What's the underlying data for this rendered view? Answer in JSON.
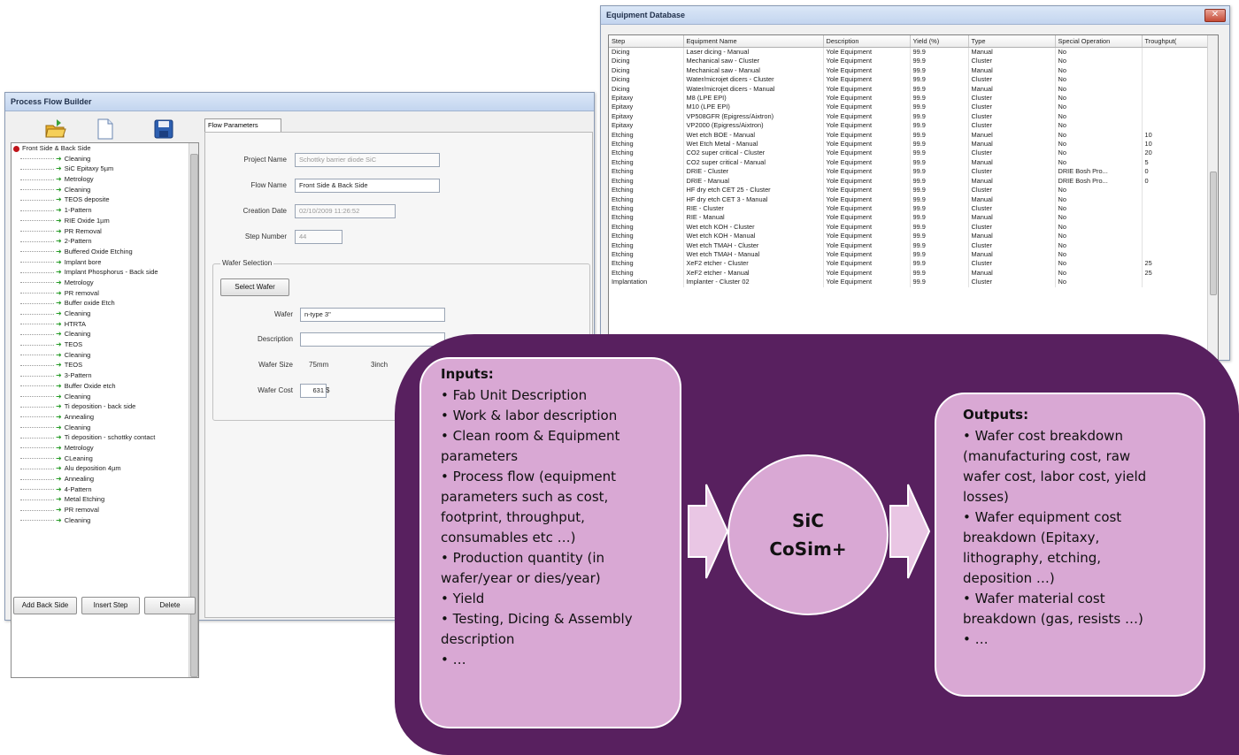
{
  "process_flow_builder": {
    "title": "Process Flow Builder",
    "toolbar_icons": [
      "folder-open-icon",
      "new-document-icon",
      "save-icon"
    ],
    "tree": {
      "root": "Front Side & Back Side",
      "items": [
        "Cleaning",
        "SiC Epitaxy 5µm",
        "Metrology",
        "Cleaning",
        "TEOS deposite",
        "1-Pattern",
        "RIE Oxide 1µm",
        "PR Removal",
        "2-Pattern",
        "Buffered Oxide Etching",
        "Implant bore",
        "Implant Phosphorus - Back side",
        "Metrology",
        "PR removal",
        "Buffer oxide Etch",
        "Cleaning",
        "HTRTA",
        "Cleaning",
        "TEOS",
        "Cleaning",
        "TEOS",
        "3-Pattern",
        "Buffer Oxide etch",
        "Cleaning",
        "Ti deposition - back side",
        "Annealing",
        "Cleaning",
        "Ti deposition - schottky contact",
        "Metrology",
        "CLeaning",
        "Alu deposition 4µm",
        "Annealing",
        "4-Pattern",
        "Metal Etching",
        "PR removal",
        "Cleaning"
      ]
    },
    "buttons": {
      "add_back_side": "Add Back Side",
      "insert_step": "Insert Step",
      "delete": "Delete"
    },
    "tab_label": "Flow Parameters",
    "form": {
      "project_name_label": "Project Name",
      "project_name_value": "Schottky barrier diode SiC",
      "flow_name_label": "Flow Name",
      "flow_name_value": "Front Side & Back Side",
      "creation_date_label": "Creation Date",
      "creation_date_value": "02/10/2009 11:26:52",
      "step_number_label": "Step Number",
      "step_number_value": "44"
    },
    "wafer_selection": {
      "title": "Wafer Selection",
      "select_button": "Select Wafer",
      "wafer_label": "Wafer",
      "wafer_value": "n-type 3\"",
      "description_label": "Description",
      "description_value": "",
      "wafer_size_label": "Wafer Size",
      "wafer_size_mm": "75mm",
      "wafer_size_inch": "3inch",
      "wafer_cost_label": "Wafer Cost",
      "wafer_cost_value": "631",
      "wafer_cost_unit": "$"
    }
  },
  "equipment_database": {
    "title": "Equipment Database",
    "close_label": "✕",
    "columns": [
      "Step",
      "Equipment Name",
      "Description",
      "Yield (%)",
      "Type",
      "Special Operation",
      "Troughput("
    ],
    "rows": [
      [
        "Dicing",
        "Laser dicing - Manual",
        "Yole Equipment",
        "99.9",
        "Manual",
        "No",
        ""
      ],
      [
        "Dicing",
        "Mechanical saw - Cluster",
        "Yole Equipment",
        "99.9",
        "Cluster",
        "No",
        ""
      ],
      [
        "Dicing",
        "Mechanical saw - Manual",
        "Yole Equipment",
        "99.9",
        "Manual",
        "No",
        ""
      ],
      [
        "Dicing",
        "Water/microjet dicers - Cluster",
        "Yole Equipment",
        "99.9",
        "Cluster",
        "No",
        ""
      ],
      [
        "Dicing",
        "Water/microjet dicers - Manual",
        "Yole Equipment",
        "99.9",
        "Manual",
        "No",
        ""
      ],
      [
        "Epitaxy",
        "M8 (LPE EPI)",
        "Yole Equipment",
        "99.9",
        "Cluster",
        "No",
        ""
      ],
      [
        "Epitaxy",
        "M10 (LPE EPI)",
        "Yole Equipment",
        "99.9",
        "Cluster",
        "No",
        ""
      ],
      [
        "Epitaxy",
        "VP508GFR (Epigress/Aixtron)",
        "Yole Equipment",
        "99.9",
        "Cluster",
        "No",
        ""
      ],
      [
        "Epitaxy",
        "VP2000 (Epigress/Aixtron)",
        "Yole Equipment",
        "99.9",
        "Cluster",
        "No",
        ""
      ],
      [
        "Etching",
        "Wet etch BOE - Manual",
        "Yole Equipment",
        "99.9",
        "Manuel",
        "No",
        "10"
      ],
      [
        "Etching",
        "Wet Etch Metal - Manual",
        "Yole Equipment",
        "99.9",
        "Manual",
        "No",
        "10"
      ],
      [
        "Etching",
        "CO2 super critical - Cluster",
        "Yole Equipment",
        "99.9",
        "Cluster",
        "No",
        "20"
      ],
      [
        "Etching",
        "CO2 super critical - Manual",
        "Yole Equipment",
        "99.9",
        "Manual",
        "No",
        "5"
      ],
      [
        "Etching",
        "DRIE - Cluster",
        "Yole Equipment",
        "99.9",
        "Cluster",
        "DRIE Bosh Pro...",
        "0"
      ],
      [
        "Etching",
        "DRIE - Manual",
        "Yole Equipment",
        "99.9",
        "Manual",
        "DRIE Bosh Pro...",
        "0"
      ],
      [
        "Etching",
        "HF dry etch CET 25 - Cluster",
        "Yole Equipment",
        "99.9",
        "Cluster",
        "No",
        ""
      ],
      [
        "Etching",
        "HF dry etch CET 3 - Manual",
        "Yole Equipment",
        "99.9",
        "Manual",
        "No",
        ""
      ],
      [
        "Etching",
        "RIE - Cluster",
        "Yole Equipment",
        "99.9",
        "Cluster",
        "No",
        ""
      ],
      [
        "Etching",
        "RIE - Manual",
        "Yole Equipment",
        "99.9",
        "Manual",
        "No",
        ""
      ],
      [
        "Etching",
        "Wet etch KOH - Cluster",
        "Yole Equipment",
        "99.9",
        "Cluster",
        "No",
        ""
      ],
      [
        "Etching",
        "Wet etch KOH - Manual",
        "Yole Equipment",
        "99.9",
        "Manual",
        "No",
        ""
      ],
      [
        "Etching",
        "Wet etch TMAH - Cluster",
        "Yole Equipment",
        "99.9",
        "Cluster",
        "No",
        ""
      ],
      [
        "Etching",
        "Wet etch TMAH - Manual",
        "Yole Equipment",
        "99.9",
        "Manual",
        "No",
        ""
      ],
      [
        "Etching",
        "XeF2 etcher - Cluster",
        "Yole Equipment",
        "99.9",
        "Cluster",
        "No",
        "25"
      ],
      [
        "Etching",
        "XeF2 etcher - Manual",
        "Yole Equipment",
        "99.9",
        "Manual",
        "No",
        "25"
      ],
      [
        "Implantation",
        "Implanter - Cluster 02",
        "Yole Equipment",
        "99.9",
        "Cluster",
        "No",
        ""
      ]
    ]
  },
  "overlay": {
    "inputs_title": "Inputs:",
    "inputs": [
      "• Fab Unit Description",
      "• Work & labor description",
      "• Clean room & Equipment",
      "parameters",
      "• Process flow (equipment",
      "parameters such as cost,",
      "footprint, throughput,",
      "consumables etc …)",
      "• Production quantity (in",
      "wafer/year or dies/year)",
      "• Yield",
      "• Testing, Dicing & Assembly",
      "description",
      "• …"
    ],
    "center_line1": "SiC",
    "center_line2": "CoSim+",
    "outputs_title": "Outputs:",
    "outputs": [
      "• Wafer cost breakdown",
      "(manufacturing cost, raw",
      "wafer cost, labor cost, yield",
      "losses)",
      "• Wafer equipment cost",
      "breakdown (Epitaxy,",
      "lithography, etching,",
      "deposition …)",
      "• Wafer material cost",
      "breakdown (gas, resists …)",
      "• …"
    ],
    "colors": {
      "background": "#58205f",
      "box": "#d9a8d4",
      "arrow": "#e9c6e4"
    }
  }
}
